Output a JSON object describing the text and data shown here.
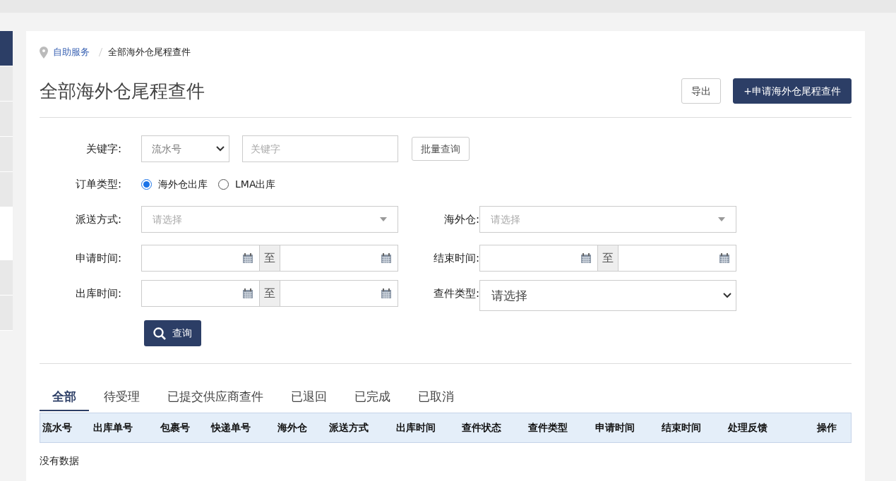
{
  "sidebar": {
    "items": [
      {
        "selected": true
      },
      {
        "selected": false
      },
      {
        "selected": false
      },
      {
        "selected": false
      },
      {
        "selected": false
      },
      {
        "selected": false
      },
      {
        "selected": false
      }
    ]
  },
  "breadcrumb": [
    "自助服务",
    "全部海外仓尾程查件"
  ],
  "title": "全部海外仓尾程查件",
  "header_buttons": [
    {
      "label": "导出",
      "kind": "default"
    },
    {
      "label": "+申请海外仓尾程查件",
      "kind": "primary"
    }
  ],
  "form": {
    "keyword": {
      "label": "关键字:",
      "type_value": "流水号",
      "placeholder": "关键字",
      "batch_button": "批量查询"
    },
    "order_type": {
      "label": "订单类型:",
      "options": [
        {
          "label": "海外仓出库",
          "selected": true
        },
        {
          "label": "LMA出库",
          "selected": false
        }
      ]
    },
    "delivery_method": {
      "label": "派送方式:",
      "placeholder": "请选择"
    },
    "warehouse": {
      "label": "海外仓:",
      "placeholder": "请选择"
    },
    "apply_time": {
      "label": "申请时间:",
      "separator": "至"
    },
    "end_time": {
      "label": "结束时间:",
      "separator": "至"
    },
    "outbound_time": {
      "label": "出库时间:",
      "separator": "至"
    },
    "inquiry_type": {
      "label": "查件类型:",
      "value": "请选择"
    },
    "search_button": "查询"
  },
  "tabs": [
    {
      "label": "全部",
      "selected": true
    },
    {
      "label": "待受理",
      "selected": false
    },
    {
      "label": "已提交供应商查件",
      "selected": false
    },
    {
      "label": "已退回",
      "selected": false
    },
    {
      "label": "已完成",
      "selected": false
    },
    {
      "label": "已取消",
      "selected": false
    }
  ],
  "table": {
    "columns": [
      "流水号",
      "出库单号",
      "包裹号",
      "快递单号",
      "海外仓",
      "派送方式",
      "出库时间",
      "查件状态",
      "查件类型",
      "申请时间",
      "结束时间",
      "处理反馈",
      "操作"
    ],
    "empty_text": "没有数据"
  }
}
